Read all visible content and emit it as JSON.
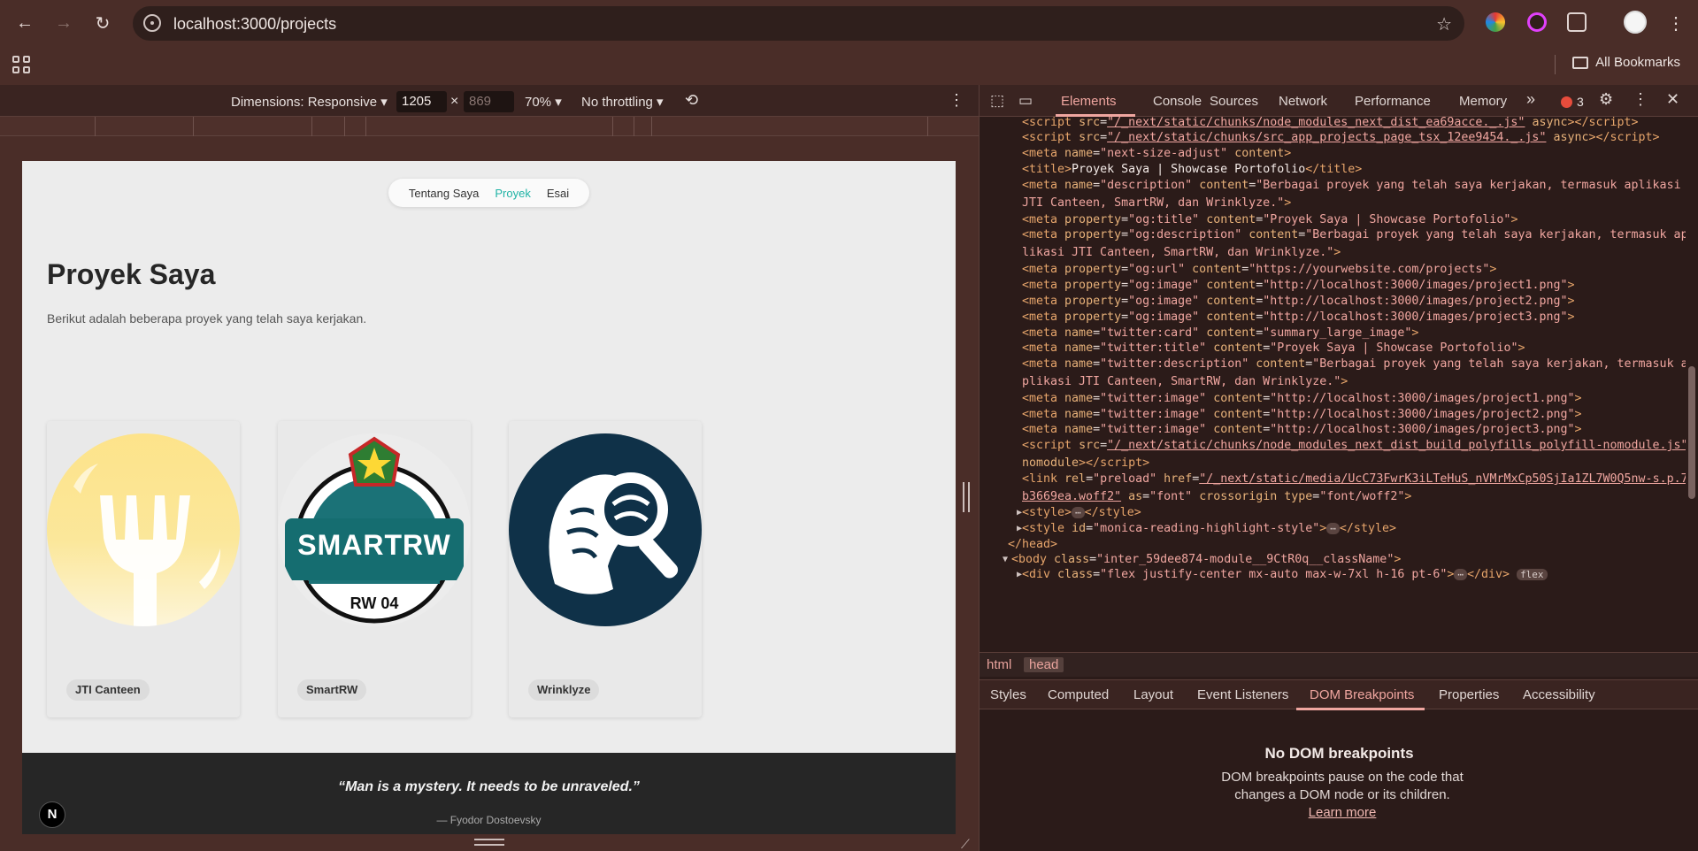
{
  "browser": {
    "url": "localhost:3000/projects",
    "bookmarks_label": "All Bookmarks"
  },
  "device_toolbar": {
    "dimensions_label": "Dimensions: Responsive ▾",
    "width": "1205",
    "height_placeholder": "869",
    "times": "×",
    "zoom": "70% ▾",
    "throttling": "No throttling ▾"
  },
  "page": {
    "nav": {
      "about": "Tentang Saya",
      "projects": "Proyek",
      "essays": "Esai"
    },
    "title": "Proyek Saya",
    "subtitle": "Berikut adalah beberapa proyek yang telah saya kerjakan.",
    "projects": [
      {
        "name": "JTI Canteen"
      },
      {
        "name": "SmartRW",
        "logo_text": "SMARTRW",
        "logo_sub": "RW 04"
      },
      {
        "name": "Wrinklyze"
      }
    ],
    "quote": "“Man is a mystery. It needs to be unraveled.”",
    "author": "— Fyodor Dostoevsky",
    "badge": "N"
  },
  "devtools": {
    "tabs": [
      "Elements",
      "Console",
      "Sources",
      "Network",
      "Performance",
      "Memory"
    ],
    "more": "»",
    "error_count": "3",
    "breadcrumbs": [
      "html",
      "head"
    ],
    "sub_tabs": [
      "Styles",
      "Computed",
      "Layout",
      "Event Listeners",
      "DOM Breakpoints",
      "Properties",
      "Accessibility"
    ],
    "empty_title": "No DOM breakpoints",
    "empty_desc": "DOM breakpoints pause on the code that changes a DOM node or its children.",
    "learn_more": "Learn more"
  },
  "colors": {
    "accent": "#1fb3a5",
    "devtools_accent": "#f0a6a0",
    "error": "#e74c3c"
  }
}
